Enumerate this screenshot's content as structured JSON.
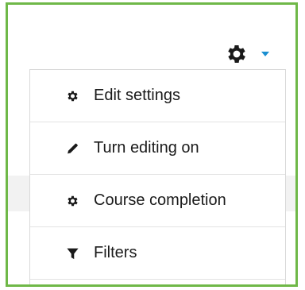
{
  "settings_toggle": {
    "icon": "gear-icon",
    "caret_icon": "caret-down-icon",
    "caret_color": "#1a8fd1"
  },
  "menu": {
    "items": [
      {
        "label": "Edit settings",
        "icon": "gear-icon"
      },
      {
        "label": "Turn editing on",
        "icon": "pencil-icon"
      },
      {
        "label": "Course completion",
        "icon": "gear-icon"
      },
      {
        "label": "Filters",
        "icon": "filter-icon"
      }
    ]
  },
  "colors": {
    "frame_border": "#6fb848",
    "text": "#1a1a1a",
    "icon": "#1a1a1a"
  }
}
